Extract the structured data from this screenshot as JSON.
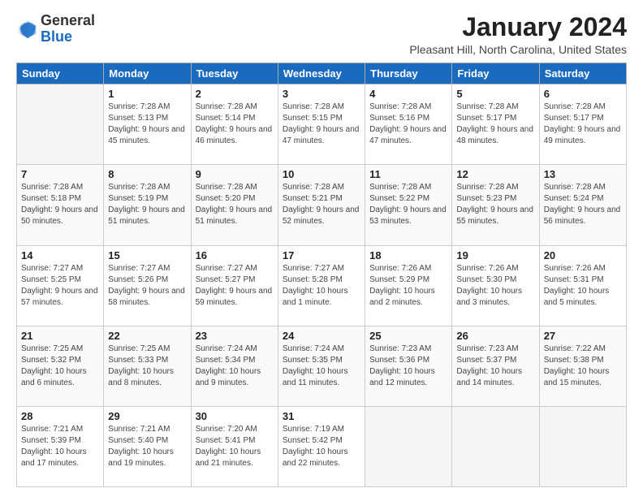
{
  "logo": {
    "general": "General",
    "blue": "Blue"
  },
  "header": {
    "month_year": "January 2024",
    "location": "Pleasant Hill, North Carolina, United States"
  },
  "days_of_week": [
    "Sunday",
    "Monday",
    "Tuesday",
    "Wednesday",
    "Thursday",
    "Friday",
    "Saturday"
  ],
  "weeks": [
    [
      {
        "date": "",
        "sunrise": "",
        "sunset": "",
        "daylight": "",
        "empty": true
      },
      {
        "date": "1",
        "sunrise": "Sunrise: 7:28 AM",
        "sunset": "Sunset: 5:13 PM",
        "daylight": "Daylight: 9 hours and 45 minutes.",
        "empty": false
      },
      {
        "date": "2",
        "sunrise": "Sunrise: 7:28 AM",
        "sunset": "Sunset: 5:14 PM",
        "daylight": "Daylight: 9 hours and 46 minutes.",
        "empty": false
      },
      {
        "date": "3",
        "sunrise": "Sunrise: 7:28 AM",
        "sunset": "Sunset: 5:15 PM",
        "daylight": "Daylight: 9 hours and 47 minutes.",
        "empty": false
      },
      {
        "date": "4",
        "sunrise": "Sunrise: 7:28 AM",
        "sunset": "Sunset: 5:16 PM",
        "daylight": "Daylight: 9 hours and 47 minutes.",
        "empty": false
      },
      {
        "date": "5",
        "sunrise": "Sunrise: 7:28 AM",
        "sunset": "Sunset: 5:17 PM",
        "daylight": "Daylight: 9 hours and 48 minutes.",
        "empty": false
      },
      {
        "date": "6",
        "sunrise": "Sunrise: 7:28 AM",
        "sunset": "Sunset: 5:17 PM",
        "daylight": "Daylight: 9 hours and 49 minutes.",
        "empty": false
      }
    ],
    [
      {
        "date": "7",
        "sunrise": "Sunrise: 7:28 AM",
        "sunset": "Sunset: 5:18 PM",
        "daylight": "Daylight: 9 hours and 50 minutes.",
        "empty": false
      },
      {
        "date": "8",
        "sunrise": "Sunrise: 7:28 AM",
        "sunset": "Sunset: 5:19 PM",
        "daylight": "Daylight: 9 hours and 51 minutes.",
        "empty": false
      },
      {
        "date": "9",
        "sunrise": "Sunrise: 7:28 AM",
        "sunset": "Sunset: 5:20 PM",
        "daylight": "Daylight: 9 hours and 51 minutes.",
        "empty": false
      },
      {
        "date": "10",
        "sunrise": "Sunrise: 7:28 AM",
        "sunset": "Sunset: 5:21 PM",
        "daylight": "Daylight: 9 hours and 52 minutes.",
        "empty": false
      },
      {
        "date": "11",
        "sunrise": "Sunrise: 7:28 AM",
        "sunset": "Sunset: 5:22 PM",
        "daylight": "Daylight: 9 hours and 53 minutes.",
        "empty": false
      },
      {
        "date": "12",
        "sunrise": "Sunrise: 7:28 AM",
        "sunset": "Sunset: 5:23 PM",
        "daylight": "Daylight: 9 hours and 55 minutes.",
        "empty": false
      },
      {
        "date": "13",
        "sunrise": "Sunrise: 7:28 AM",
        "sunset": "Sunset: 5:24 PM",
        "daylight": "Daylight: 9 hours and 56 minutes.",
        "empty": false
      }
    ],
    [
      {
        "date": "14",
        "sunrise": "Sunrise: 7:27 AM",
        "sunset": "Sunset: 5:25 PM",
        "daylight": "Daylight: 9 hours and 57 minutes.",
        "empty": false
      },
      {
        "date": "15",
        "sunrise": "Sunrise: 7:27 AM",
        "sunset": "Sunset: 5:26 PM",
        "daylight": "Daylight: 9 hours and 58 minutes.",
        "empty": false
      },
      {
        "date": "16",
        "sunrise": "Sunrise: 7:27 AM",
        "sunset": "Sunset: 5:27 PM",
        "daylight": "Daylight: 9 hours and 59 minutes.",
        "empty": false
      },
      {
        "date": "17",
        "sunrise": "Sunrise: 7:27 AM",
        "sunset": "Sunset: 5:28 PM",
        "daylight": "Daylight: 10 hours and 1 minute.",
        "empty": false
      },
      {
        "date": "18",
        "sunrise": "Sunrise: 7:26 AM",
        "sunset": "Sunset: 5:29 PM",
        "daylight": "Daylight: 10 hours and 2 minutes.",
        "empty": false
      },
      {
        "date": "19",
        "sunrise": "Sunrise: 7:26 AM",
        "sunset": "Sunset: 5:30 PM",
        "daylight": "Daylight: 10 hours and 3 minutes.",
        "empty": false
      },
      {
        "date": "20",
        "sunrise": "Sunrise: 7:26 AM",
        "sunset": "Sunset: 5:31 PM",
        "daylight": "Daylight: 10 hours and 5 minutes.",
        "empty": false
      }
    ],
    [
      {
        "date": "21",
        "sunrise": "Sunrise: 7:25 AM",
        "sunset": "Sunset: 5:32 PM",
        "daylight": "Daylight: 10 hours and 6 minutes.",
        "empty": false
      },
      {
        "date": "22",
        "sunrise": "Sunrise: 7:25 AM",
        "sunset": "Sunset: 5:33 PM",
        "daylight": "Daylight: 10 hours and 8 minutes.",
        "empty": false
      },
      {
        "date": "23",
        "sunrise": "Sunrise: 7:24 AM",
        "sunset": "Sunset: 5:34 PM",
        "daylight": "Daylight: 10 hours and 9 minutes.",
        "empty": false
      },
      {
        "date": "24",
        "sunrise": "Sunrise: 7:24 AM",
        "sunset": "Sunset: 5:35 PM",
        "daylight": "Daylight: 10 hours and 11 minutes.",
        "empty": false
      },
      {
        "date": "25",
        "sunrise": "Sunrise: 7:23 AM",
        "sunset": "Sunset: 5:36 PM",
        "daylight": "Daylight: 10 hours and 12 minutes.",
        "empty": false
      },
      {
        "date": "26",
        "sunrise": "Sunrise: 7:23 AM",
        "sunset": "Sunset: 5:37 PM",
        "daylight": "Daylight: 10 hours and 14 minutes.",
        "empty": false
      },
      {
        "date": "27",
        "sunrise": "Sunrise: 7:22 AM",
        "sunset": "Sunset: 5:38 PM",
        "daylight": "Daylight: 10 hours and 15 minutes.",
        "empty": false
      }
    ],
    [
      {
        "date": "28",
        "sunrise": "Sunrise: 7:21 AM",
        "sunset": "Sunset: 5:39 PM",
        "daylight": "Daylight: 10 hours and 17 minutes.",
        "empty": false
      },
      {
        "date": "29",
        "sunrise": "Sunrise: 7:21 AM",
        "sunset": "Sunset: 5:40 PM",
        "daylight": "Daylight: 10 hours and 19 minutes.",
        "empty": false
      },
      {
        "date": "30",
        "sunrise": "Sunrise: 7:20 AM",
        "sunset": "Sunset: 5:41 PM",
        "daylight": "Daylight: 10 hours and 21 minutes.",
        "empty": false
      },
      {
        "date": "31",
        "sunrise": "Sunrise: 7:19 AM",
        "sunset": "Sunset: 5:42 PM",
        "daylight": "Daylight: 10 hours and 22 minutes.",
        "empty": false
      },
      {
        "date": "",
        "sunrise": "",
        "sunset": "",
        "daylight": "",
        "empty": true
      },
      {
        "date": "",
        "sunrise": "",
        "sunset": "",
        "daylight": "",
        "empty": true
      },
      {
        "date": "",
        "sunrise": "",
        "sunset": "",
        "daylight": "",
        "empty": true
      }
    ]
  ]
}
